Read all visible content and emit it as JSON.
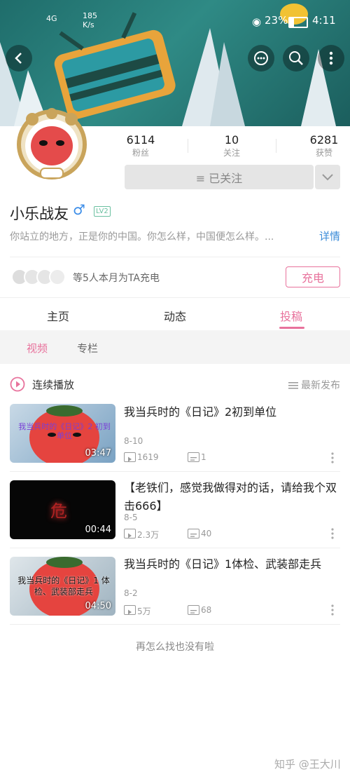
{
  "status_bar": {
    "network": "4G",
    "speed": "185 K/s",
    "battery": "23%",
    "time": "4:11"
  },
  "header": {
    "back_icon": "arrow-left-icon",
    "actions": [
      "chat-icon",
      "search-icon",
      "more-vertical-icon"
    ]
  },
  "profile": {
    "name": "小乐战友",
    "gender": "♂",
    "level": "LV2",
    "bio": "你站立的地方，正是你的中国。你怎么样，中国便怎么样。...",
    "detail_label": "详情",
    "stats": [
      {
        "value": "6114",
        "label": "粉丝"
      },
      {
        "value": "10",
        "label": "关注"
      },
      {
        "value": "6281",
        "label": "获赞"
      }
    ],
    "follow_label": "≡ 已关注",
    "charge_text": "等5人本月为TA充电",
    "charge_button": "充电"
  },
  "tabs": [
    {
      "label": "主页",
      "active": false
    },
    {
      "label": "动态",
      "active": false
    },
    {
      "label": "投稿",
      "active": true
    }
  ],
  "subtabs": [
    {
      "label": "视频",
      "active": true
    },
    {
      "label": "专栏",
      "active": false
    }
  ],
  "list_header": {
    "play_all": "连续播放",
    "sort": "最新发布"
  },
  "videos": [
    {
      "title": "我当兵时的《日记》2初到单位",
      "date": "8-10",
      "plays": "1619",
      "comments": "1",
      "duration": "03:47",
      "thumb_text": "我当兵时的《日记》2 初到单位"
    },
    {
      "title": "【老铁们，感觉我做得对的话，请给我个双击666】",
      "date": "8-5",
      "plays": "2.3万",
      "comments": "40",
      "duration": "00:44",
      "thumb_text": "危"
    },
    {
      "title": "我当兵时的《日记》1体检、武装部走兵",
      "date": "8-2",
      "plays": "5万",
      "comments": "68",
      "duration": "04:50",
      "thumb_text": "我当兵时的《日记》1 体检、武装部走兵"
    }
  ],
  "footer_text": "再怎么找也没有啦",
  "watermark": "知乎 @王大川",
  "colors": {
    "accent": "#e8729c",
    "banner": "#2f8a85"
  }
}
